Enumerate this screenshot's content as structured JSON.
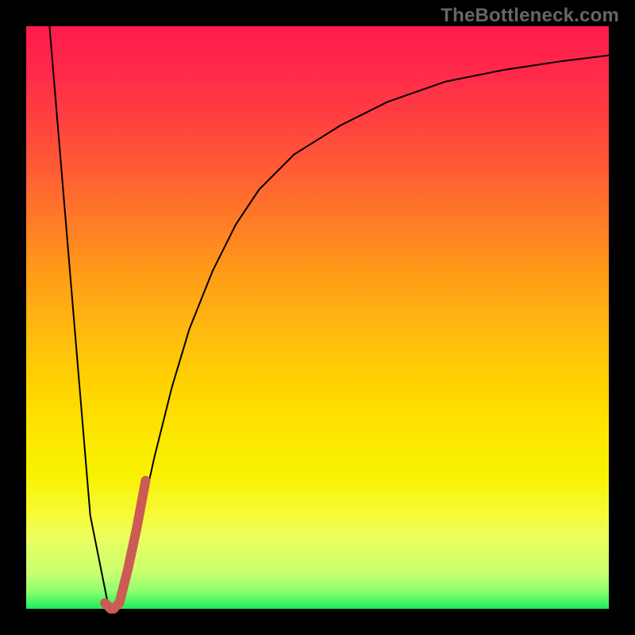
{
  "watermark": "TheBottleneck.com",
  "chart_data": {
    "type": "line",
    "title": "",
    "xlabel": "",
    "ylabel": "",
    "xlim": [
      0,
      100
    ],
    "ylim": [
      0,
      100
    ],
    "grid": false,
    "legend": false,
    "background_gradient_top": "#ff1a4d",
    "background_gradient_bottom": "#1eec5a",
    "series": [
      {
        "name": "black-curve",
        "color": "#000000",
        "stroke_width": 2,
        "x": [
          4,
          8,
          11,
          14,
          15,
          16,
          18,
          20,
          22,
          25,
          28,
          32,
          36,
          40,
          46,
          54,
          62,
          72,
          82,
          92,
          100
        ],
        "values": [
          100,
          52,
          16,
          1,
          0,
          1,
          8,
          17,
          26,
          38,
          48,
          58,
          66,
          72,
          78,
          83,
          87,
          90.5,
          92.5,
          94,
          95
        ]
      },
      {
        "name": "red-overlay-segment",
        "color": "#cc5a55",
        "stroke_width": 12,
        "x": [
          13.5,
          14.5,
          15,
          16,
          17.5,
          19,
          20.5
        ],
        "values": [
          1,
          0,
          0,
          1,
          7,
          14,
          22
        ]
      }
    ]
  }
}
